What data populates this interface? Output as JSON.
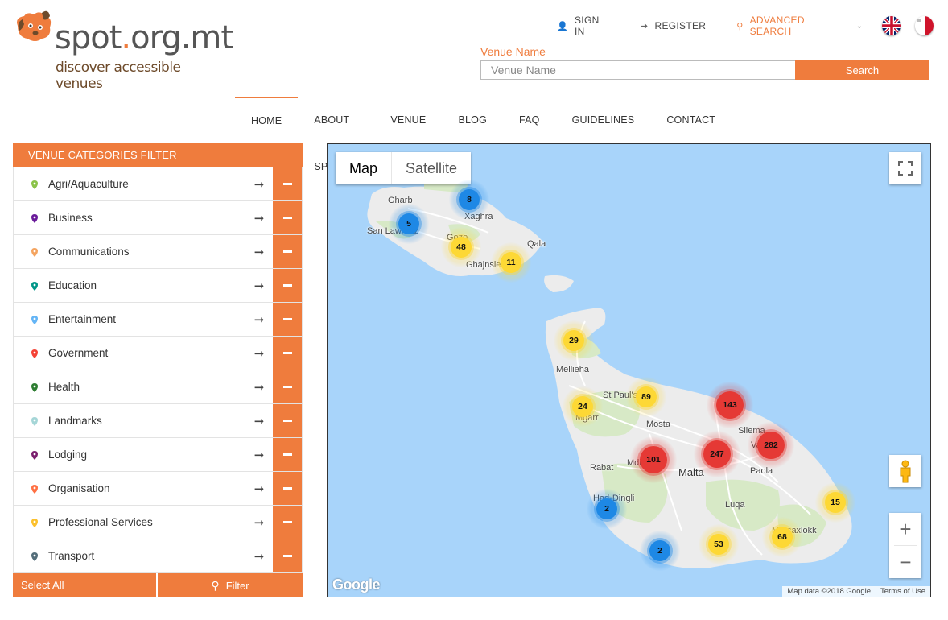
{
  "logo": {
    "main": "spot",
    "dot": ".",
    "suffix": "org.mt",
    "tagline": "discover accessible venues"
  },
  "header": {
    "sign_in": "SIGN IN",
    "register": "REGISTER",
    "advanced_search": "ADVANCED SEARCH",
    "languages": [
      "english-flag",
      "maltese-flag"
    ]
  },
  "search": {
    "label": "Venue Name",
    "placeholder": "Venue Name",
    "value": "",
    "button": "Search"
  },
  "nav": [
    "HOME",
    "ABOUT SPOT",
    "VENUE",
    "BLOG",
    "FAQ",
    "GUIDELINES",
    "CONTACT US"
  ],
  "sidebar": {
    "title": "VENUE CATEGORIES FILTER",
    "items": [
      {
        "label": "Agri/Aquaculture",
        "color": "#8bc34a"
      },
      {
        "label": "Business",
        "color": "#6a1b9a"
      },
      {
        "label": "Communications",
        "color": "#f4a460"
      },
      {
        "label": "Education",
        "color": "#009688"
      },
      {
        "label": "Entertainment",
        "color": "#64b5f6"
      },
      {
        "label": "Government",
        "color": "#f44336"
      },
      {
        "label": "Health",
        "color": "#2e7d32"
      },
      {
        "label": "Landmarks",
        "color": "#a5d6d7"
      },
      {
        "label": "Lodging",
        "color": "#7b1f6e"
      },
      {
        "label": "Organisation",
        "color": "#ff7043"
      },
      {
        "label": "Professional Services",
        "color": "#fbc02d"
      },
      {
        "label": "Transport",
        "color": "#546e7a"
      }
    ],
    "select_all": "Select All",
    "filter": "Filter"
  },
  "map": {
    "type_map": "Map",
    "type_satellite": "Satellite",
    "google": "Google",
    "attribution": "Map data ©2018 Google",
    "terms": "Terms of Use",
    "places": [
      "Gharb",
      "Xaghra",
      "San Lawrenz",
      "Gozo",
      "Qala",
      "Ghajnsielem",
      "Mellieha",
      "St Paul's Bay",
      "Mgarr",
      "Mosta",
      "Sliema",
      "Valletta",
      "Mdina",
      "Rabat",
      "Malta",
      "Paola",
      "Had-Dingli",
      "Luqa",
      "Marsaxlokk"
    ],
    "clusters": [
      8,
      5,
      48,
      11,
      29,
      24,
      89,
      143,
      101,
      247,
      282,
      2,
      15,
      53,
      68,
      2
    ],
    "colors": {
      "blue": "#1e88e5",
      "yellow": "#fdd835",
      "red": "#e53935"
    }
  }
}
